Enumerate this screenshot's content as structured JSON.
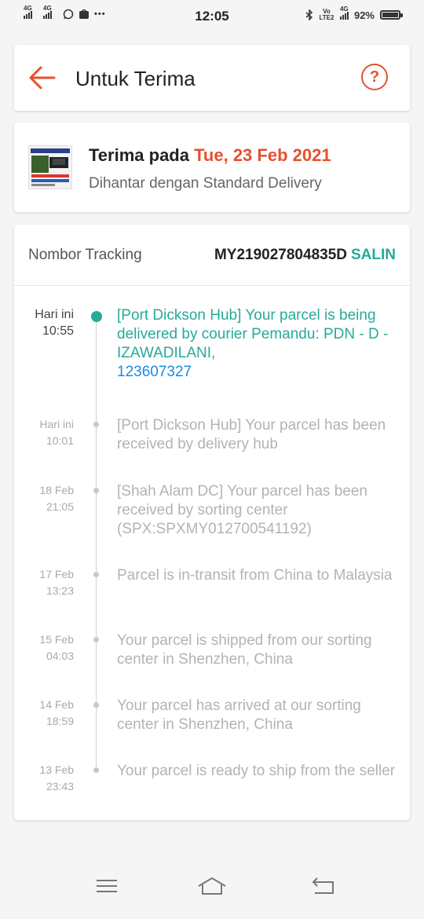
{
  "status_bar": {
    "network1": "4G",
    "network2": "4G",
    "time": "12:05",
    "volte": "Vo LTE2",
    "network3": "4G",
    "battery_percent": "92%",
    "battery_level": 0.92
  },
  "header": {
    "title": "Untuk Terima",
    "help_symbol": "?",
    "back_icon": "arrow-left-icon",
    "help_icon": "question-circle-icon"
  },
  "delivery": {
    "received_label": "Terima pada",
    "received_date": "Tue, 23 Feb 2021",
    "method": "Dihantar dengan Standard Delivery"
  },
  "tracking": {
    "label": "Nombor Tracking",
    "number": "MY219027804835D",
    "copy_label": "SALIN",
    "events": [
      {
        "day": "Hari ini",
        "time": "10:55",
        "text": "[Port Dickson Hub] Your parcel is being delivered by courier Pemandu: PDN - D - IZAWADILANI,",
        "phone": "123607327"
      },
      {
        "day": "Hari ini",
        "time": "10:01",
        "text": "[Port Dickson Hub] Your parcel has been received by delivery hub"
      },
      {
        "day": "18 Feb",
        "time": "21:05",
        "text": "[Shah Alam DC] Your parcel has been received by sorting center (SPX:SPXMY012700541192)"
      },
      {
        "day": "17 Feb",
        "time": "13:23",
        "text": "Parcel is in-transit from China to Malaysia"
      },
      {
        "day": "15 Feb",
        "time": "04:03",
        "text": "Your parcel is shipped from our sorting center in Shenzhen, China"
      },
      {
        "day": "14 Feb",
        "time": "18:59",
        "text": "Your parcel has arrived at our sorting center in Shenzhen, China"
      },
      {
        "day": "13 Feb",
        "time": "23:43",
        "text": "Your parcel is ready to ship from the seller"
      }
    ]
  },
  "colors": {
    "accent": "#e5502f",
    "teal": "#26aa99",
    "link": "#1e88e5"
  }
}
